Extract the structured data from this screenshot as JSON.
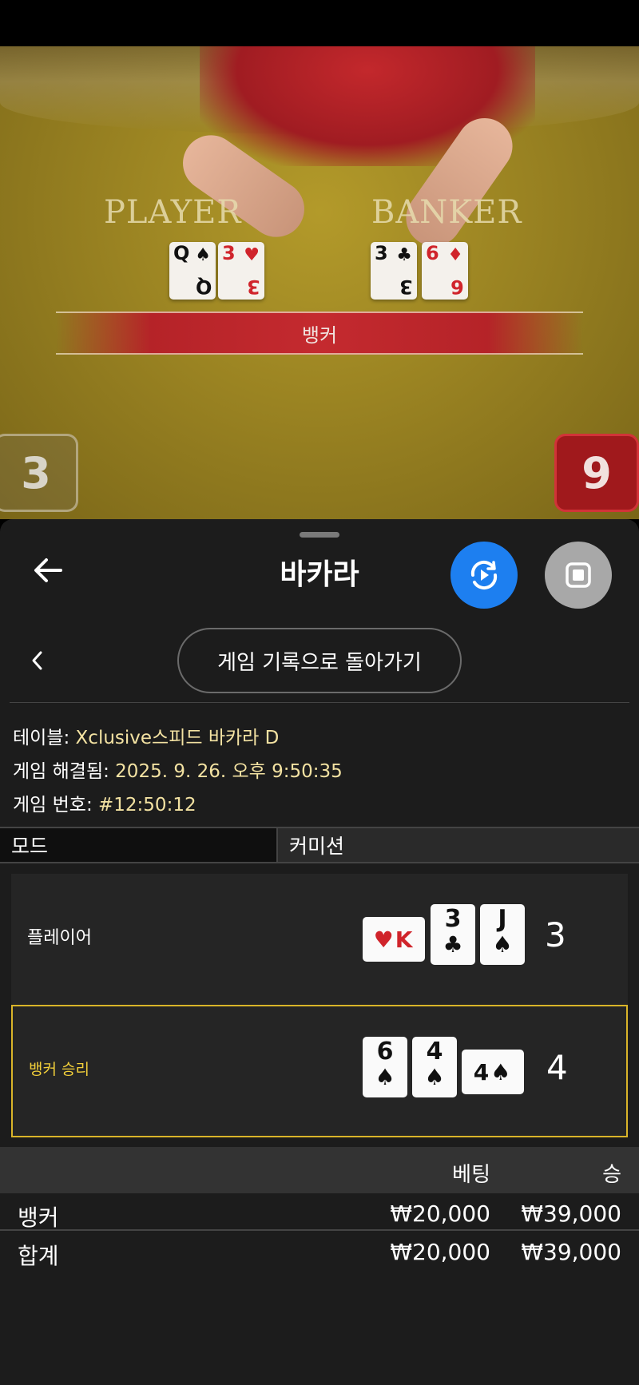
{
  "video": {
    "table_labels": {
      "player": "PLAYER",
      "banker": "BANKER"
    },
    "player_cards": [
      {
        "rank": "Q",
        "suit": "♠",
        "color": "blk"
      },
      {
        "rank": "3",
        "suit": "♥",
        "color": "red"
      }
    ],
    "banker_cards": [
      {
        "rank": "3",
        "suit": "♣",
        "color": "blk"
      },
      {
        "rank": "6",
        "suit": "♦",
        "color": "red"
      }
    ],
    "result_banner": "뱅커",
    "player_score": "3",
    "banker_score": "9"
  },
  "header": {
    "title": "바카라",
    "back_icon": "arrow-left-icon",
    "replay_icon": "replay-icon",
    "stop_icon": "stop-icon"
  },
  "nav": {
    "history_button": "게임 기록으로 돌아가기"
  },
  "info": {
    "table_label": "테이블: ",
    "table_value": "Xclusive스피드 바카라 D",
    "resolved_label": "게임 해결됨: ",
    "resolved_value": "2025. 9. 26. 오후 9:50:35",
    "game_no_label": "게임 번호: ",
    "game_no_value": "#12:50:12"
  },
  "mode": {
    "label": "모드",
    "value": "커미션"
  },
  "hands": {
    "player": {
      "label": "플레이어",
      "total": "3",
      "cards": [
        {
          "rank": "K",
          "suit": "♥",
          "color": "red",
          "orientation": "side"
        },
        {
          "rank": "3",
          "suit": "♣",
          "color": "blk",
          "orientation": "up"
        },
        {
          "rank": "J",
          "suit": "♠",
          "color": "blk",
          "orientation": "up"
        }
      ]
    },
    "banker": {
      "label": "뱅커 승리",
      "total": "4",
      "cards": [
        {
          "rank": "6",
          "suit": "♠",
          "color": "blk",
          "orientation": "up"
        },
        {
          "rank": "4",
          "suit": "♠",
          "color": "blk",
          "orientation": "up"
        },
        {
          "rank": "4",
          "suit": "♠",
          "color": "blk",
          "orientation": "side"
        }
      ]
    }
  },
  "bets": {
    "headers": {
      "bet": "베팅",
      "win": "승"
    },
    "rows": [
      {
        "name": "뱅커",
        "bet": "₩20,000",
        "win": "₩39,000"
      },
      {
        "name": "합계",
        "bet": "₩20,000",
        "win": "₩39,000"
      }
    ]
  },
  "colors": {
    "accent_blue": "#1d7ff0",
    "winner_gold": "#f2cf3a",
    "banker_red": "#a0191c"
  }
}
